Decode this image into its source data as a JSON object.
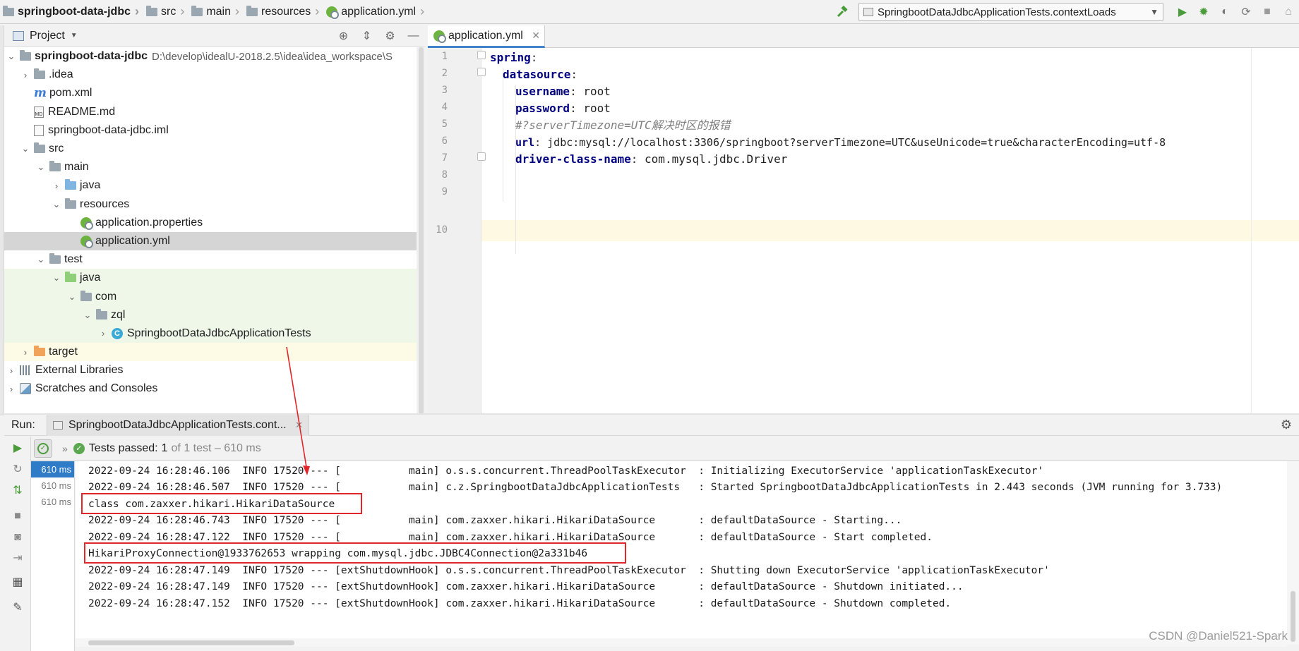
{
  "breadcrumb": [
    {
      "label": "springboot-data-jdbc",
      "icon": "folder-icon"
    },
    {
      "label": "src",
      "icon": "folder-icon"
    },
    {
      "label": "main",
      "icon": "folder-icon"
    },
    {
      "label": "resources",
      "icon": "resources-folder-icon"
    },
    {
      "label": "application.yml",
      "icon": "spring-yml-icon"
    }
  ],
  "toolbar": {
    "run_config": "SpringbootDataJdbcApplicationTests.contextLoads",
    "icons": [
      "build-hammer-icon",
      "run-icon",
      "debug-icon",
      "coverage-icon",
      "profile-icon",
      "stop-icon",
      "sync-icon"
    ]
  },
  "project_panel": {
    "title": "Project",
    "tools": [
      "locate-icon",
      "collapse-icon",
      "gear-icon",
      "minimize-icon"
    ],
    "tree": [
      {
        "label": "springboot-data-jdbc",
        "path": "D:\\develop\\idealU-2018.2.5\\idea\\idea_workspace\\S",
        "type": "module",
        "expanded": true
      },
      {
        "label": ".idea",
        "type": "folder",
        "expanded": false
      },
      {
        "label": "pom.xml",
        "type": "maven"
      },
      {
        "label": "README.md",
        "type": "md"
      },
      {
        "label": "springboot-data-jdbc.iml",
        "type": "iml"
      },
      {
        "label": "src",
        "type": "folder",
        "expanded": true
      },
      {
        "label": "main",
        "type": "folder",
        "expanded": true
      },
      {
        "label": "java",
        "type": "source-folder",
        "expanded": false
      },
      {
        "label": "resources",
        "type": "resources-folder",
        "expanded": true
      },
      {
        "label": "application.properties",
        "type": "spring-config"
      },
      {
        "label": "application.yml",
        "type": "spring-config",
        "selected": true
      },
      {
        "label": "test",
        "type": "folder",
        "expanded": true
      },
      {
        "label": "java",
        "type": "test-folder",
        "expanded": true
      },
      {
        "label": "com",
        "type": "package",
        "expanded": true
      },
      {
        "label": "zql",
        "type": "package",
        "expanded": true
      },
      {
        "label": "SpringbootDataJdbcApplicationTests",
        "type": "class",
        "expanded": false
      },
      {
        "label": "target",
        "type": "excluded-folder",
        "expanded": false
      },
      {
        "label": "External Libraries",
        "type": "libraries",
        "expanded": false
      },
      {
        "label": "Scratches and Consoles",
        "type": "scratches",
        "expanded": false
      }
    ]
  },
  "editor": {
    "tab_label": "application.yml",
    "line_numbers": [
      "1",
      "2",
      "3",
      "4",
      "5",
      "6",
      "7",
      "8",
      "9",
      "10"
    ],
    "lines": [
      {
        "key": "spring",
        "sep": ":",
        "value": ""
      },
      {
        "key": "datasource",
        "sep": ":",
        "value": ""
      },
      {
        "key": "username",
        "sep": ":",
        "value": " root"
      },
      {
        "key": "password",
        "sep": ":",
        "value": " root"
      },
      {
        "comment": "#?serverTimezone=UTC解决时区的报错"
      },
      {
        "key": "url",
        "sep": ":",
        "value": " jdbc:mysql://localhost:3306/springboot?serverTimezone=UTC&useUnicode=true&characterEncoding=utf-8"
      },
      {
        "key": "driver-class-name",
        "sep": ":",
        "value": " com.mysql.jdbc.Driver"
      }
    ]
  },
  "run_panel": {
    "label": "Run:",
    "tab_label": "SpringbootDataJdbcApplicationTests.cont...",
    "status": {
      "passed_label": "Tests passed:",
      "passed_count": "1",
      "rest": "of 1 test – 610 ms"
    },
    "test_times": [
      "610 ms",
      "610 ms",
      "610 ms"
    ],
    "side_icons": [
      "rerun-icon",
      "rerun-failed-icon",
      "toggle-auto-test-icon",
      "stop-icon",
      "camera-icon",
      "import-icon",
      "layout-icon",
      "pin-icon"
    ],
    "console": [
      "2022-09-24 16:28:46.106  INFO 17520 --- [           main] o.s.s.concurrent.ThreadPoolTaskExecutor  : Initializing ExecutorService 'applicationTaskExecutor'",
      "2022-09-24 16:28:46.507  INFO 17520 --- [           main] c.z.SpringbootDataJdbcApplicationTests   : Started SpringbootDataJdbcApplicationTests in 2.443 seconds (JVM running for 3.733)",
      "class com.zaxxer.hikari.HikariDataSource",
      "2022-09-24 16:28:46.743  INFO 17520 --- [           main] com.zaxxer.hikari.HikariDataSource       : defaultDataSource - Starting...",
      "2022-09-24 16:28:47.122  INFO 17520 --- [           main] com.zaxxer.hikari.HikariDataSource       : defaultDataSource - Start completed.",
      "HikariProxyConnection@1933762653 wrapping com.mysql.jdbc.JDBC4Connection@2a331b46",
      "2022-09-24 16:28:47.149  INFO 17520 --- [extShutdownHook] o.s.s.concurrent.ThreadPoolTaskExecutor  : Shutting down ExecutorService 'applicationTaskExecutor'",
      "2022-09-24 16:28:47.149  INFO 17520 --- [extShutdownHook] com.zaxxer.hikari.HikariDataSource       : defaultDataSource - Shutdown initiated...",
      "2022-09-24 16:28:47.152  INFO 17520 --- [extShutdownHook] com.zaxxer.hikari.HikariDataSource       : defaultDataSource - Shutdown completed."
    ]
  },
  "watermark": "CSDN @Daniel521-Spark",
  "colors": {
    "accent": "#4083c9",
    "annotation": "#e0262a",
    "yaml_key": "#000080",
    "selection": "#2f7bc7"
  }
}
